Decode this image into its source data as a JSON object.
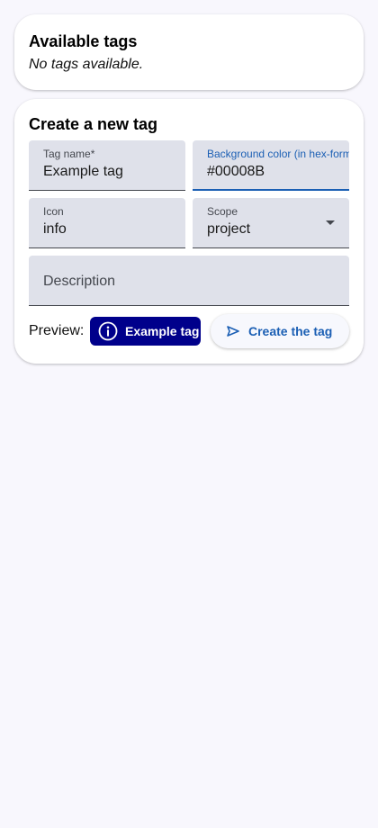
{
  "available_tags": {
    "title": "Available tags",
    "empty_message": "No tags available."
  },
  "create_tag": {
    "title": "Create a new tag",
    "fields": {
      "tag_name": {
        "label": "Tag name*",
        "value": "Example tag"
      },
      "background_color": {
        "label": "Background color (in hex-format)",
        "value": "#00008B"
      },
      "icon": {
        "label": "Icon",
        "value": "info"
      },
      "scope": {
        "label": "Scope",
        "value": "project"
      },
      "description": {
        "placeholder": "Description",
        "value": ""
      }
    },
    "preview": {
      "label": "Preview:",
      "chip_text": "Example tag",
      "chip_icon": "info-icon",
      "chip_color": "#00008B"
    },
    "submit": {
      "label": "Create the tag",
      "icon": "send-icon"
    }
  },
  "colors": {
    "accent": "#1B5FB4",
    "page_background": "#F8F7FD",
    "field_background": "#DFE1EA"
  }
}
